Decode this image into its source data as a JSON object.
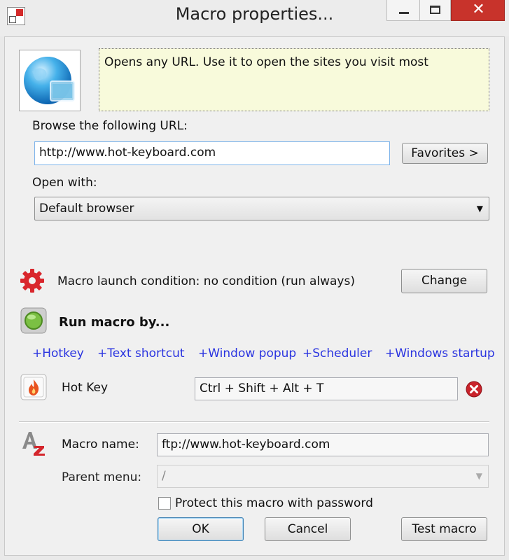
{
  "window": {
    "title": "Macro properties...",
    "controls": {
      "minimize": "minimize",
      "maximize": "maximize",
      "close": "close"
    }
  },
  "description": "Opens any URL. Use it to open the sites you visit most",
  "url_section": {
    "label": "Browse the following URL:",
    "value": "http://www.hot-keyboard.com",
    "favorites_button": "Favorites >"
  },
  "open_with": {
    "label": "Open with:",
    "selected": "Default browser"
  },
  "launch_condition": {
    "text": "Macro launch condition: no condition (run always)",
    "change_button": "Change"
  },
  "run_by": {
    "label": "Run macro by...",
    "links": [
      "+Hotkey",
      "+Text shortcut",
      "+Window popup",
      "+Scheduler",
      "+Windows startup"
    ]
  },
  "hotkey": {
    "label": "Hot Key",
    "value": "Ctrl + Shift + Alt + T"
  },
  "macro": {
    "name_label": "Macro name:",
    "name_value": "ftp://www.hot-keyboard.com",
    "parent_label": "Parent menu:",
    "parent_value": "/"
  },
  "password": {
    "label": "Protect this macro with password",
    "checked": false
  },
  "buttons": {
    "ok": "OK",
    "cancel": "Cancel",
    "test": "Test macro"
  },
  "icons": {
    "app": "app-icon",
    "globe": "globe-icon",
    "gear": "gear-icon",
    "run": "green-button-icon",
    "hotkey": "flame-icon",
    "remove": "remove-icon",
    "macro_name": "az-icon"
  },
  "colors": {
    "link": "#2b35e0",
    "close_button": "#c8332b",
    "description_bg": "#f8fadb"
  }
}
